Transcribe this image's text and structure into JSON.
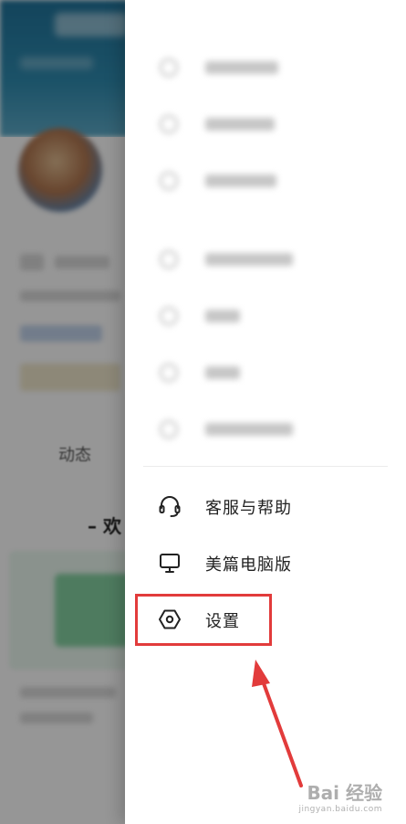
{
  "background_page": {
    "tab_label": "动态",
    "welcome_text": "– 欢"
  },
  "drawer": {
    "menu": [
      {
        "label": "客服与帮助",
        "icon": "headset-icon"
      },
      {
        "label": "美篇电脑版",
        "icon": "monitor-icon"
      },
      {
        "label": "设置",
        "icon": "settings-hexagon-icon"
      }
    ]
  },
  "annotation": {
    "highlight_color": "#e23b3b",
    "arrow_color": "#e23b3b"
  },
  "watermark": {
    "text": "Bai 经验",
    "sub": "jingyan.baidu.com"
  }
}
